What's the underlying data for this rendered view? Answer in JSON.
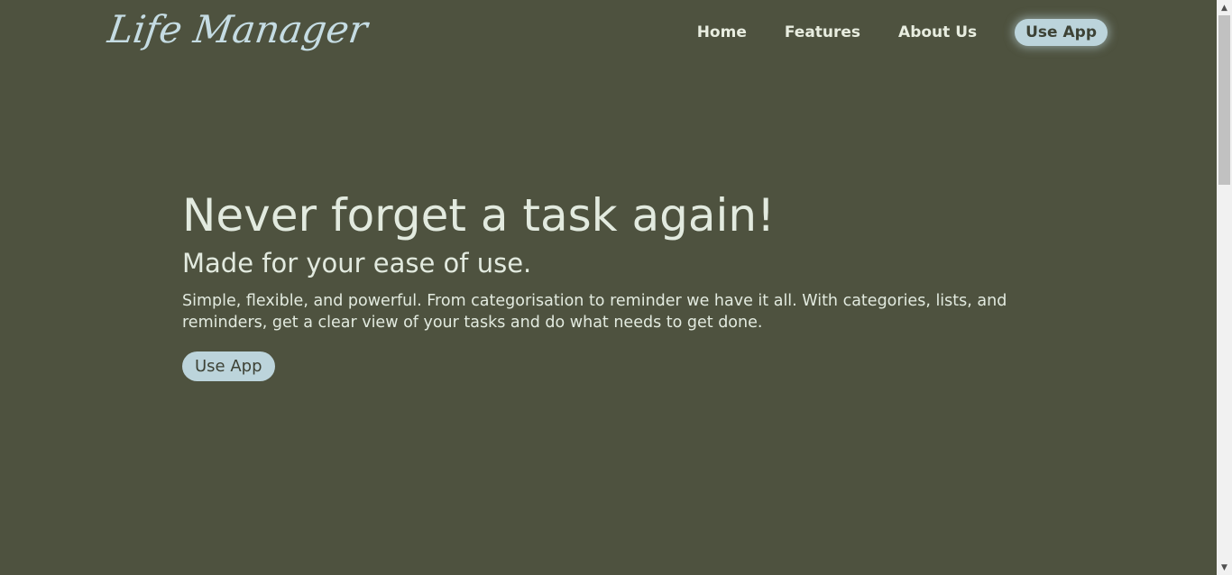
{
  "header": {
    "logo": "Life Manager",
    "nav": {
      "home": "Home",
      "features": "Features",
      "about": "About Us",
      "cta": "Use App"
    }
  },
  "hero": {
    "title": "Never forget a task again!",
    "subtitle": "Made for your ease of use.",
    "text": "Simple, flexible, and powerful. From categorisation to reminder we have it all. With categories, lists, and reminders, get a clear view of your tasks and do what needs to get done.",
    "button": "Use App"
  },
  "colors": {
    "background": "#4e523f",
    "accent": "#bcd4db",
    "logo": "#c5dce3",
    "text": "#e2eadf"
  },
  "icons": {
    "scroll_up": "chevron-up-icon",
    "scroll_down": "chevron-down-icon"
  }
}
